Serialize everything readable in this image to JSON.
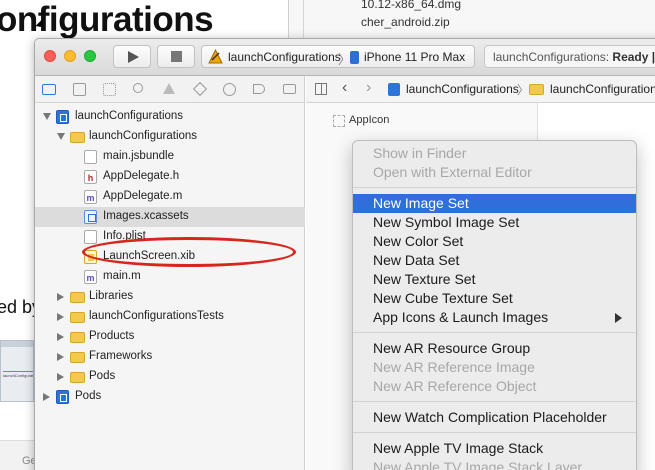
{
  "background": {
    "doc_title": "onfigurations",
    "doc_partial_text": "ed by",
    "thumb_text": "launchConfigurations",
    "bottom_partial": "Ge",
    "files": [
      "10.12-x86_64.dmg",
      "cher_android.zip"
    ]
  },
  "toolbar": {
    "scheme": "launchConfigurations",
    "device": "iPhone 11 Pro Max",
    "status_prefix": "launchConfigurations: ",
    "status_state": "Ready | L"
  },
  "navigator": {
    "rows": [
      {
        "label": "launchConfigurations",
        "icon": "project",
        "indent": 0,
        "disclosure": "open"
      },
      {
        "label": "launchConfigurations",
        "icon": "folder",
        "indent": 1,
        "disclosure": "open"
      },
      {
        "label": "main.jsbundle",
        "icon": "file",
        "indent": 2,
        "disclosure": "none"
      },
      {
        "label": "AppDelegate.h",
        "icon": "h-file",
        "indent": 2,
        "disclosure": "none"
      },
      {
        "label": "AppDelegate.m",
        "icon": "m-file",
        "indent": 2,
        "disclosure": "none"
      },
      {
        "label": "Images.xcassets",
        "icon": "assets",
        "indent": 2,
        "disclosure": "none",
        "selected": true
      },
      {
        "label": "Info.plist",
        "icon": "file",
        "indent": 2,
        "disclosure": "none"
      },
      {
        "label": "LaunchScreen.xib",
        "icon": "xib",
        "indent": 2,
        "disclosure": "none"
      },
      {
        "label": "main.m",
        "icon": "m-file",
        "indent": 2,
        "disclosure": "none"
      },
      {
        "label": "Libraries",
        "icon": "folder",
        "indent": 1,
        "disclosure": "closed"
      },
      {
        "label": "launchConfigurationsTests",
        "icon": "folder",
        "indent": 1,
        "disclosure": "closed"
      },
      {
        "label": "Products",
        "icon": "folder",
        "indent": 1,
        "disclosure": "closed"
      },
      {
        "label": "Frameworks",
        "icon": "folder",
        "indent": 1,
        "disclosure": "closed"
      },
      {
        "label": "Pods",
        "icon": "folder",
        "indent": 1,
        "disclosure": "closed"
      },
      {
        "label": "Pods",
        "icon": "project",
        "indent": 0,
        "disclosure": "closed"
      }
    ]
  },
  "editor": {
    "jump_project": "launchConfigurations",
    "jump_folder": "launchConfiguration",
    "asset_item": "AppIcon"
  },
  "context_menu": {
    "groups": [
      [
        {
          "label": "Show in Finder",
          "enabled": false
        },
        {
          "label": "Open with External Editor",
          "enabled": false
        }
      ],
      [
        {
          "label": "New Image Set",
          "enabled": true,
          "highlighted": true
        },
        {
          "label": "New Symbol Image Set",
          "enabled": true
        },
        {
          "label": "New Color Set",
          "enabled": true
        },
        {
          "label": "New Data Set",
          "enabled": true
        },
        {
          "label": "New Texture Set",
          "enabled": true
        },
        {
          "label": "New Cube Texture Set",
          "enabled": true
        },
        {
          "label": "App Icons & Launch Images",
          "enabled": true,
          "submenu": true
        }
      ],
      [
        {
          "label": "New AR Resource Group",
          "enabled": true
        },
        {
          "label": "New AR Reference Image",
          "enabled": false
        },
        {
          "label": "New AR Reference Object",
          "enabled": false
        }
      ],
      [
        {
          "label": "New Watch Complication Placeholder",
          "enabled": true
        }
      ],
      [
        {
          "label": "New Apple TV Image Stack",
          "enabled": true
        },
        {
          "label": "New Apple TV Image Stack Layer",
          "enabled": false
        }
      ]
    ]
  },
  "colors": {
    "menu_highlight": "#2f6fd9",
    "annotation": "#d9261c",
    "accent": "#2d74da"
  }
}
